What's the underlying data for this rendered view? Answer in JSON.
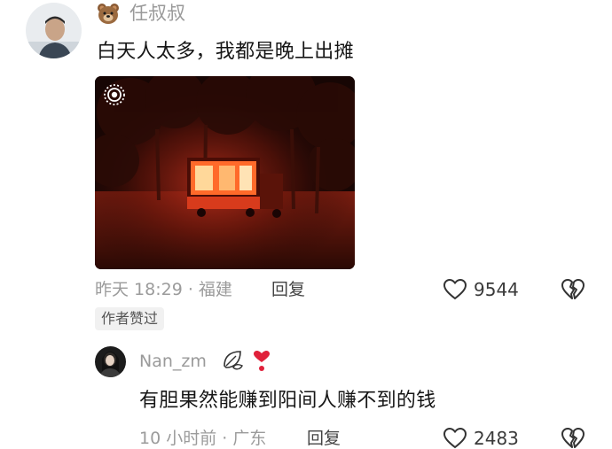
{
  "comments": [
    {
      "username": "任叔叔",
      "badge_icon": "bear-face-icon",
      "text": "白天人太多，我都是晚上出摊",
      "meta": "昨天 18:29 · 福建",
      "reply_label": "回复",
      "like_count": "9544",
      "author_tag": "作者赞过",
      "has_image": true,
      "image_icon": "live-photo-icon"
    },
    {
      "username": "Nan_zm",
      "badge_icons": [
        "leaf-sticker-icon",
        "heart-exclamation-icon"
      ],
      "text": "有胆果然能赚到阳间人赚不到的钱",
      "meta": "10 小时前 · 广东",
      "reply_label": "回复",
      "like_count": "2483"
    }
  ],
  "colors": {
    "secondary_text": "#9b9b9b",
    "primary_text": "#161616",
    "heart_red": "#e0213a",
    "tag_bg": "#f1f1f1"
  }
}
